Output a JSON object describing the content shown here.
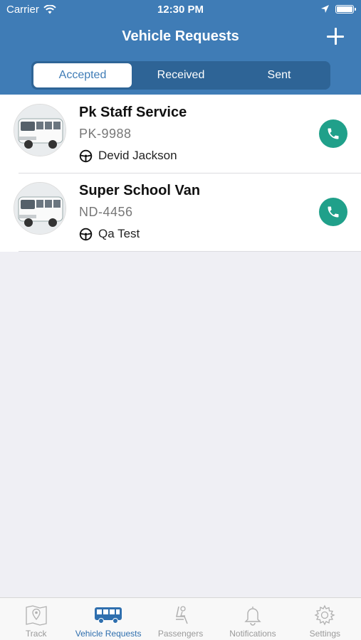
{
  "status_bar": {
    "carrier": "Carrier",
    "time": "12:30 PM"
  },
  "header": {
    "title": "Vehicle Requests",
    "add_icon": "plus-icon"
  },
  "tabs": [
    {
      "label": "Accepted",
      "active": true
    },
    {
      "label": "Received",
      "active": false
    },
    {
      "label": "Sent",
      "active": false
    }
  ],
  "requests": [
    {
      "vehicle_name": "Pk Staff Service",
      "plate": "PK-9988",
      "driver": "Devid Jackson"
    },
    {
      "vehicle_name": "Super School Van",
      "plate": "ND-4456",
      "driver": "Qa Test"
    }
  ],
  "bottom_nav": [
    {
      "label": "Track",
      "icon": "map-pin-icon",
      "active": false
    },
    {
      "label": "Vehicle Requests",
      "icon": "bus-icon",
      "active": true
    },
    {
      "label": "Passengers",
      "icon": "seat-icon",
      "active": false
    },
    {
      "label": "Notifications",
      "icon": "bell-icon",
      "active": false
    },
    {
      "label": "Settings",
      "icon": "gear-icon",
      "active": false
    }
  ],
  "colors": {
    "header": "#3f7cb6",
    "call": "#20a08a",
    "active_tab": "#2f6fae",
    "inactive_tab": "#9a9a9a"
  }
}
